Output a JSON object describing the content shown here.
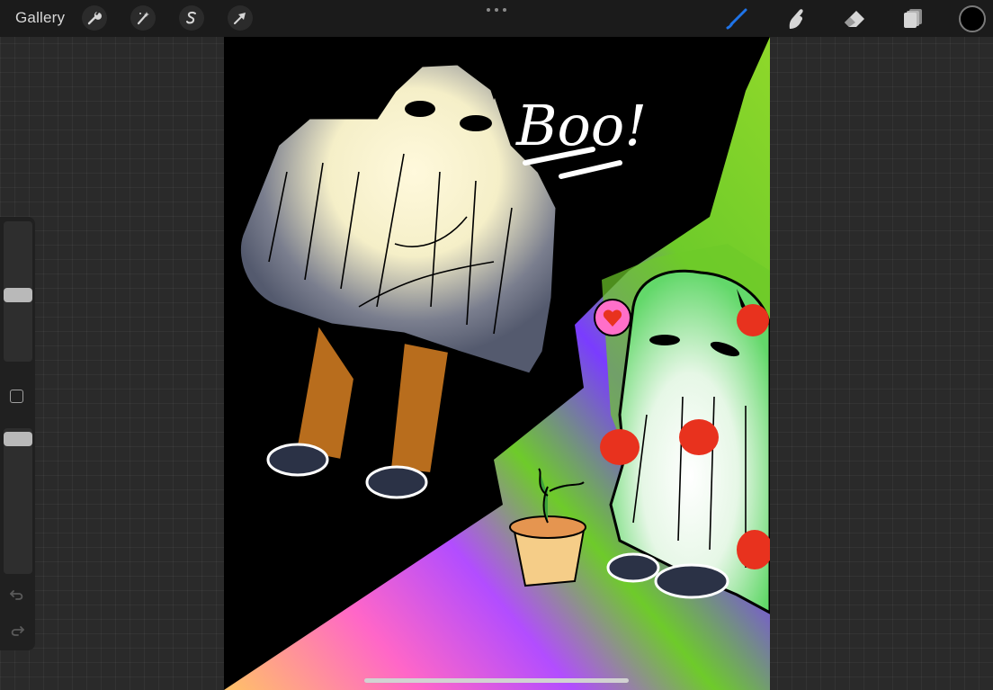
{
  "toolbar": {
    "gallery_label": "Gallery",
    "left_tools": [
      {
        "name": "actions",
        "icon": "wrench-icon"
      },
      {
        "name": "adjustments",
        "icon": "magic-wand-icon"
      },
      {
        "name": "selection",
        "icon": "selection-s-icon"
      },
      {
        "name": "transform",
        "icon": "arrow-cursor-icon"
      }
    ],
    "right_tools": [
      {
        "name": "brush",
        "icon": "brush-icon",
        "active": true
      },
      {
        "name": "smudge",
        "icon": "smudge-finger-icon"
      },
      {
        "name": "eraser",
        "icon": "eraser-icon"
      },
      {
        "name": "layers",
        "icon": "layers-icon"
      }
    ],
    "active_color": "#000000",
    "active_tool_color": "#1f74e8"
  },
  "sidebar": {
    "brush_size_level": 0.47,
    "opacity_level": 0.95,
    "undo_icon": "undo-icon",
    "redo_icon": "redo-icon",
    "modify_icon": "square-modify-icon"
  },
  "canvas": {
    "speech_text": "Boo!",
    "background_color": "#000000",
    "accent_colors": [
      "#6ecb2a",
      "#ff66c8",
      "#7a3cff",
      "#ffc266"
    ]
  }
}
